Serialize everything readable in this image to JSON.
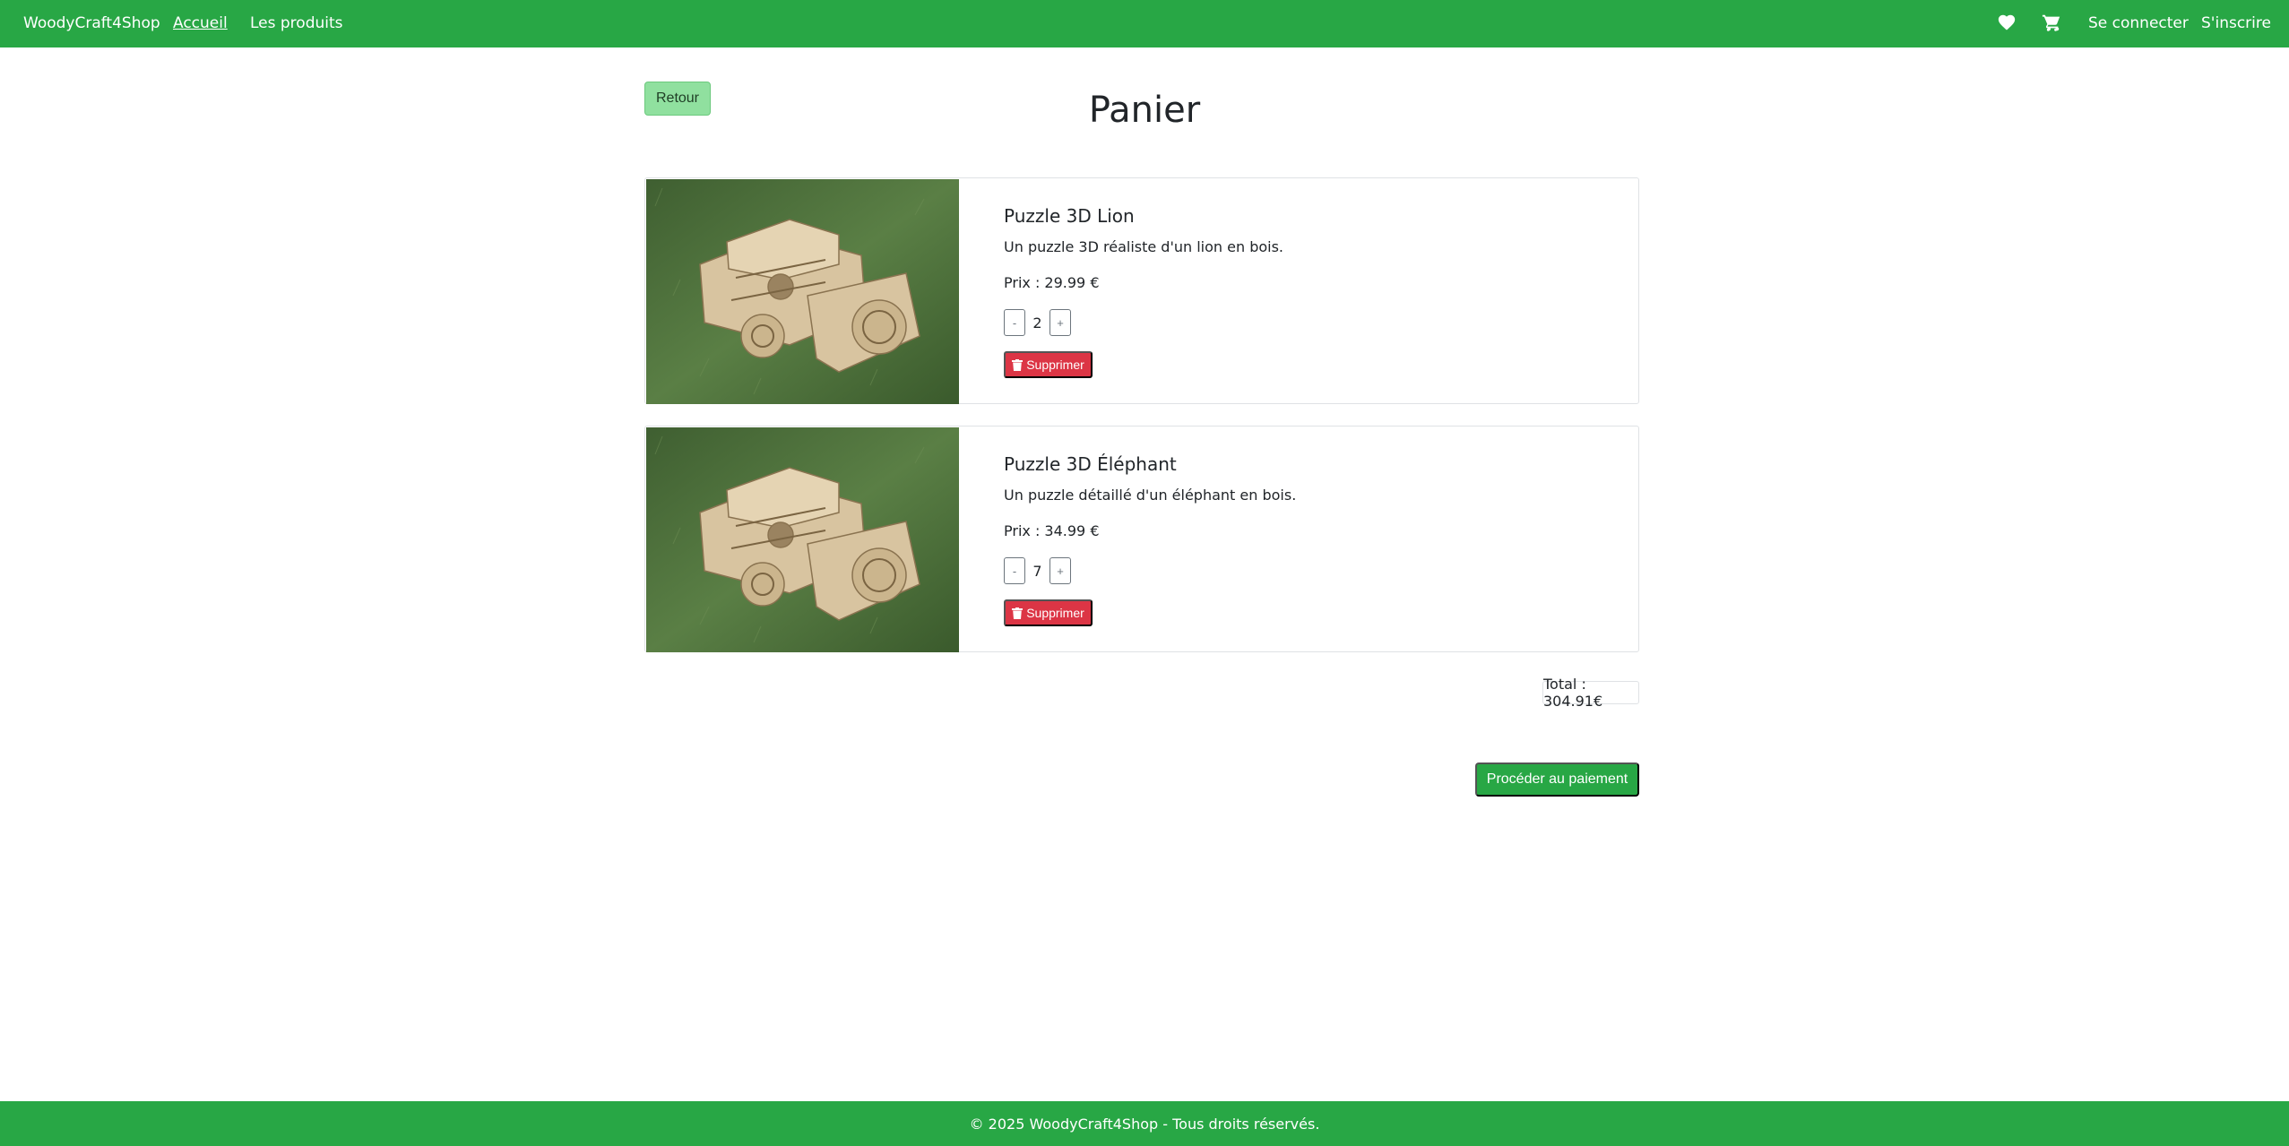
{
  "navbar": {
    "brand": "WoodyCraft4Shop",
    "links": [
      "Accueil",
      "Les produits"
    ],
    "icons": [
      "heart-icon",
      "cart-icon"
    ],
    "login": "Se connecter",
    "signup": "S'inscrire",
    "color": "#28a745"
  },
  "page": {
    "back": "Retour",
    "title": "Panier"
  },
  "cart": {
    "items": [
      {
        "name": "Puzzle 3D Lion",
        "description": "Un puzzle 3D réaliste d'un lion en bois.",
        "price": "Prix : 29.99 €",
        "quantity": "2",
        "minus": "-",
        "plus": "+",
        "delete": "Supprimer"
      },
      {
        "name": "Puzzle 3D Éléphant",
        "description": "Un puzzle détaillé d'un éléphant en bois.",
        "price": "Prix : 34.99 €",
        "quantity": "7",
        "minus": "-",
        "plus": "+",
        "delete": "Supprimer"
      }
    ],
    "total": "Total : 304.91€",
    "checkout": "Procéder au paiement"
  },
  "footer": {
    "text": "© 2025 WoodyCraft4Shop - Tous droits réservés."
  },
  "colors": {
    "delete": "#dc3545",
    "back": "#90e09f"
  }
}
